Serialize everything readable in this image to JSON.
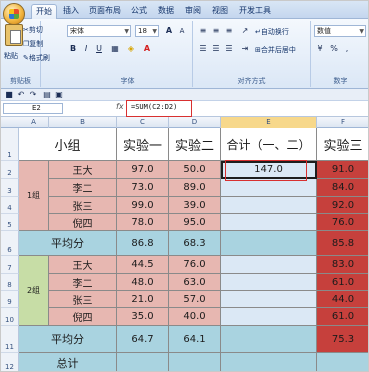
{
  "ribbon": {
    "tabs": [
      "开始",
      "插入",
      "页面布局",
      "公式",
      "数据",
      "审阅",
      "视图",
      "开发工具"
    ],
    "active_tab": "开始",
    "clipboard": {
      "cut": "剪切",
      "copy": "复制",
      "format_painter": "格式刷",
      "paste": "粘贴",
      "label": "剪贴板"
    },
    "font": {
      "name": "宋体",
      "size": "18",
      "bold": "B",
      "italic": "I",
      "underline": "U",
      "label": "字体",
      "grow": "A",
      "shrink": "A"
    },
    "alignment": {
      "wrap": "自动换行",
      "merge": "合并后居中",
      "label": "对齐方式"
    },
    "number": {
      "format": "数值",
      "percent": "%",
      "comma": ",",
      "label": "数字"
    }
  },
  "formula_bar": {
    "name_box": "E2",
    "fx": "fx",
    "formula": "=SUM(C2:D2)"
  },
  "columns": [
    "A",
    "B",
    "C",
    "D",
    "E",
    "F"
  ],
  "rows": [
    "1",
    "2",
    "3",
    "4",
    "5",
    "6",
    "7",
    "8",
    "9",
    "10",
    "11",
    "12"
  ],
  "headers": {
    "group": "小组",
    "exp1": "实验一",
    "exp2": "实验二",
    "total": "合计（一、二）",
    "exp3": "实验三"
  },
  "group1": {
    "name": "1组",
    "members": [
      {
        "name": "王大",
        "exp1": "97.0",
        "exp2": "50.0",
        "total": "147.0",
        "exp3": "91.0"
      },
      {
        "name": "李二",
        "exp1": "73.0",
        "exp2": "89.0",
        "total": "",
        "exp3": "84.0"
      },
      {
        "name": "张三",
        "exp1": "99.0",
        "exp2": "39.0",
        "total": "",
        "exp3": "92.0"
      },
      {
        "name": "倪四",
        "exp1": "78.0",
        "exp2": "95.0",
        "total": "",
        "exp3": "76.0"
      }
    ],
    "avg_label": "平均分",
    "avg_exp1": "86.8",
    "avg_exp2": "68.3",
    "avg_exp3": "85.8"
  },
  "group2": {
    "name": "2组",
    "members": [
      {
        "name": "王大",
        "exp1": "44.5",
        "exp2": "76.0",
        "exp3": "83.0"
      },
      {
        "name": "李二",
        "exp1": "48.0",
        "exp2": "63.0",
        "exp3": "61.0"
      },
      {
        "name": "张三",
        "exp1": "21.0",
        "exp2": "57.0",
        "exp3": "44.0"
      },
      {
        "name": "倪四",
        "exp1": "35.0",
        "exp2": "40.0",
        "exp3": "61.0"
      }
    ],
    "avg_label": "平均分",
    "avg_exp1": "64.7",
    "avg_exp2": "64.1",
    "avg_exp3": "75.3"
  },
  "total_label": "总计",
  "colors": {
    "pink": "#e7b7b1",
    "green": "#c7dda6",
    "blue": "#a9d3e0",
    "red": "#c6403c",
    "selection_blue": "#dbe8f5",
    "group_green": "#d3e4b8"
  }
}
